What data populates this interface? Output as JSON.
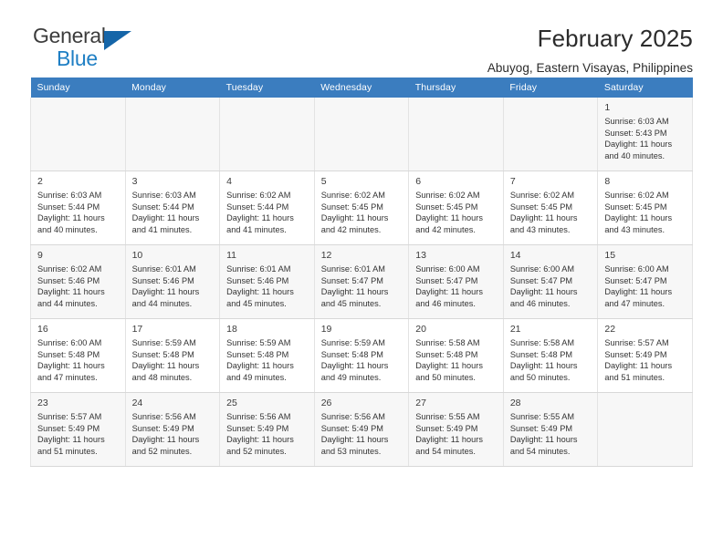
{
  "brand": {
    "name_top": "General",
    "name_bottom": "Blue",
    "triangle_color": "#1565a8",
    "blue_color": "#1f7fc4"
  },
  "header": {
    "title": "February 2025",
    "subtitle": "Abuyog, Eastern Visayas, Philippines",
    "header_bg": "#3b7dbf"
  },
  "calendar": {
    "weekday_headers": [
      "Sunday",
      "Monday",
      "Tuesday",
      "Wednesday",
      "Thursday",
      "Friday",
      "Saturday"
    ],
    "labels": {
      "sunrise": "Sunrise:",
      "sunset": "Sunset:",
      "daylight": "Daylight:"
    },
    "weeks": [
      [
        {
          "day": "",
          "empty": true
        },
        {
          "day": "",
          "empty": true
        },
        {
          "day": "",
          "empty": true
        },
        {
          "day": "",
          "empty": true
        },
        {
          "day": "",
          "empty": true
        },
        {
          "day": "",
          "empty": true
        },
        {
          "day": "1",
          "sunrise": "Sunrise: 6:03 AM",
          "sunset": "Sunset: 5:43 PM",
          "daylight": "Daylight: 11 hours and 40 minutes."
        }
      ],
      [
        {
          "day": "2",
          "sunrise": "Sunrise: 6:03 AM",
          "sunset": "Sunset: 5:44 PM",
          "daylight": "Daylight: 11 hours and 40 minutes."
        },
        {
          "day": "3",
          "sunrise": "Sunrise: 6:03 AM",
          "sunset": "Sunset: 5:44 PM",
          "daylight": "Daylight: 11 hours and 41 minutes."
        },
        {
          "day": "4",
          "sunrise": "Sunrise: 6:02 AM",
          "sunset": "Sunset: 5:44 PM",
          "daylight": "Daylight: 11 hours and 41 minutes."
        },
        {
          "day": "5",
          "sunrise": "Sunrise: 6:02 AM",
          "sunset": "Sunset: 5:45 PM",
          "daylight": "Daylight: 11 hours and 42 minutes."
        },
        {
          "day": "6",
          "sunrise": "Sunrise: 6:02 AM",
          "sunset": "Sunset: 5:45 PM",
          "daylight": "Daylight: 11 hours and 42 minutes."
        },
        {
          "day": "7",
          "sunrise": "Sunrise: 6:02 AM",
          "sunset": "Sunset: 5:45 PM",
          "daylight": "Daylight: 11 hours and 43 minutes."
        },
        {
          "day": "8",
          "sunrise": "Sunrise: 6:02 AM",
          "sunset": "Sunset: 5:45 PM",
          "daylight": "Daylight: 11 hours and 43 minutes."
        }
      ],
      [
        {
          "day": "9",
          "sunrise": "Sunrise: 6:02 AM",
          "sunset": "Sunset: 5:46 PM",
          "daylight": "Daylight: 11 hours and 44 minutes."
        },
        {
          "day": "10",
          "sunrise": "Sunrise: 6:01 AM",
          "sunset": "Sunset: 5:46 PM",
          "daylight": "Daylight: 11 hours and 44 minutes."
        },
        {
          "day": "11",
          "sunrise": "Sunrise: 6:01 AM",
          "sunset": "Sunset: 5:46 PM",
          "daylight": "Daylight: 11 hours and 45 minutes."
        },
        {
          "day": "12",
          "sunrise": "Sunrise: 6:01 AM",
          "sunset": "Sunset: 5:47 PM",
          "daylight": "Daylight: 11 hours and 45 minutes."
        },
        {
          "day": "13",
          "sunrise": "Sunrise: 6:00 AM",
          "sunset": "Sunset: 5:47 PM",
          "daylight": "Daylight: 11 hours and 46 minutes."
        },
        {
          "day": "14",
          "sunrise": "Sunrise: 6:00 AM",
          "sunset": "Sunset: 5:47 PM",
          "daylight": "Daylight: 11 hours and 46 minutes."
        },
        {
          "day": "15",
          "sunrise": "Sunrise: 6:00 AM",
          "sunset": "Sunset: 5:47 PM",
          "daylight": "Daylight: 11 hours and 47 minutes."
        }
      ],
      [
        {
          "day": "16",
          "sunrise": "Sunrise: 6:00 AM",
          "sunset": "Sunset: 5:48 PM",
          "daylight": "Daylight: 11 hours and 47 minutes."
        },
        {
          "day": "17",
          "sunrise": "Sunrise: 5:59 AM",
          "sunset": "Sunset: 5:48 PM",
          "daylight": "Daylight: 11 hours and 48 minutes."
        },
        {
          "day": "18",
          "sunrise": "Sunrise: 5:59 AM",
          "sunset": "Sunset: 5:48 PM",
          "daylight": "Daylight: 11 hours and 49 minutes."
        },
        {
          "day": "19",
          "sunrise": "Sunrise: 5:59 AM",
          "sunset": "Sunset: 5:48 PM",
          "daylight": "Daylight: 11 hours and 49 minutes."
        },
        {
          "day": "20",
          "sunrise": "Sunrise: 5:58 AM",
          "sunset": "Sunset: 5:48 PM",
          "daylight": "Daylight: 11 hours and 50 minutes."
        },
        {
          "day": "21",
          "sunrise": "Sunrise: 5:58 AM",
          "sunset": "Sunset: 5:48 PM",
          "daylight": "Daylight: 11 hours and 50 minutes."
        },
        {
          "day": "22",
          "sunrise": "Sunrise: 5:57 AM",
          "sunset": "Sunset: 5:49 PM",
          "daylight": "Daylight: 11 hours and 51 minutes."
        }
      ],
      [
        {
          "day": "23",
          "sunrise": "Sunrise: 5:57 AM",
          "sunset": "Sunset: 5:49 PM",
          "daylight": "Daylight: 11 hours and 51 minutes."
        },
        {
          "day": "24",
          "sunrise": "Sunrise: 5:56 AM",
          "sunset": "Sunset: 5:49 PM",
          "daylight": "Daylight: 11 hours and 52 minutes."
        },
        {
          "day": "25",
          "sunrise": "Sunrise: 5:56 AM",
          "sunset": "Sunset: 5:49 PM",
          "daylight": "Daylight: 11 hours and 52 minutes."
        },
        {
          "day": "26",
          "sunrise": "Sunrise: 5:56 AM",
          "sunset": "Sunset: 5:49 PM",
          "daylight": "Daylight: 11 hours and 53 minutes."
        },
        {
          "day": "27",
          "sunrise": "Sunrise: 5:55 AM",
          "sunset": "Sunset: 5:49 PM",
          "daylight": "Daylight: 11 hours and 54 minutes."
        },
        {
          "day": "28",
          "sunrise": "Sunrise: 5:55 AM",
          "sunset": "Sunset: 5:49 PM",
          "daylight": "Daylight: 11 hours and 54 minutes."
        },
        {
          "day": "",
          "empty": true
        }
      ]
    ]
  }
}
